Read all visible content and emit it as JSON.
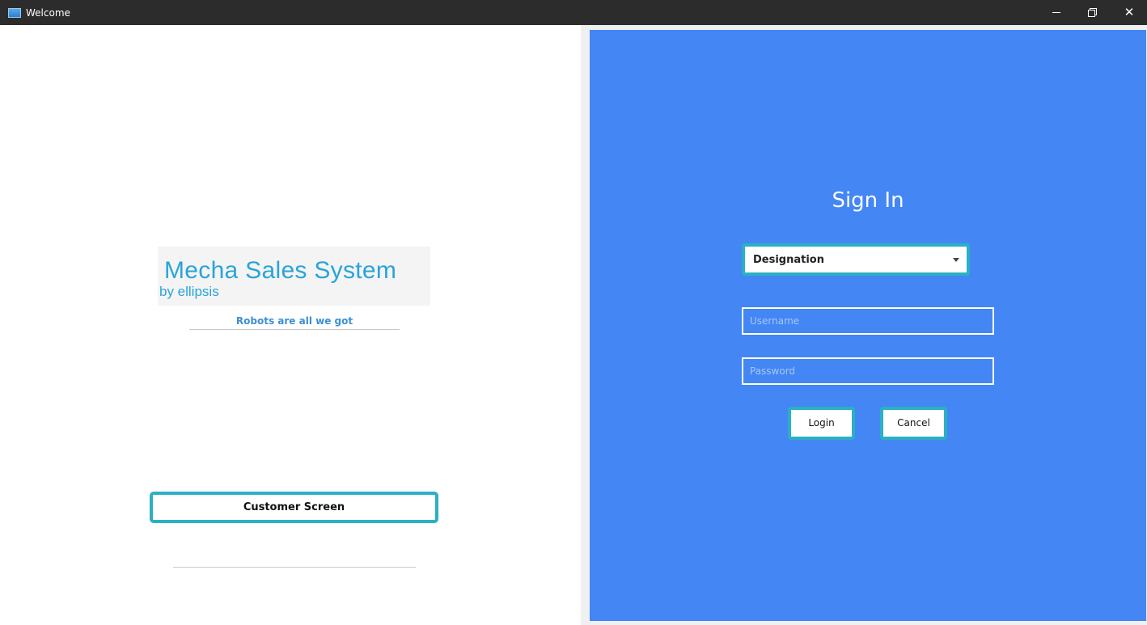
{
  "window": {
    "title": "Welcome",
    "controls": {
      "minimize": "minimize-icon",
      "maximize": "restore-icon",
      "close": "close-icon"
    }
  },
  "left": {
    "logo_title": "Mecha Sales System",
    "logo_subtitle": "by ellipsis",
    "tagline": "Robots are all we got",
    "customer_button": "Customer Screen"
  },
  "signin": {
    "title": "Sign In",
    "designation": "Designation",
    "username_placeholder": "Username",
    "password_placeholder": "Password",
    "login_label": "Login",
    "cancel_label": "Cancel"
  },
  "colors": {
    "panel_blue": "#4386f4",
    "accent_teal": "#2bb0c4",
    "logo_blue": "#2aa4d8",
    "titlebar": "#2c2c2c"
  }
}
